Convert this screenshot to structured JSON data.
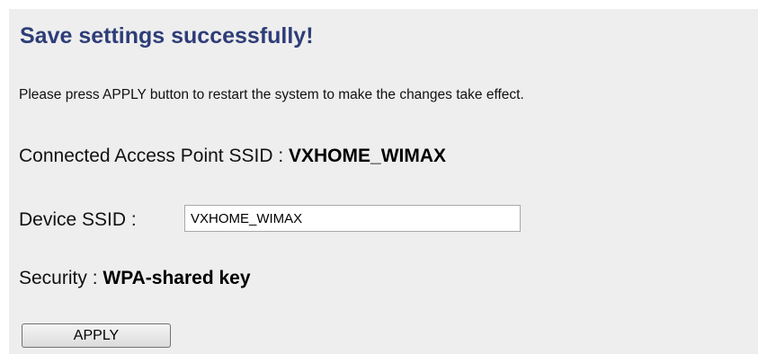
{
  "header": {
    "title": "Save settings successfully!"
  },
  "message": "Please press APPLY button to restart the system to make the changes take effect.",
  "connected_ap": {
    "label": "Connected Access Point SSID : ",
    "value": "VXHOME_WIMAX"
  },
  "device_ssid": {
    "label": "Device SSID : ",
    "value": "VXHOME_WIMAX"
  },
  "security": {
    "label": "Security : ",
    "value": "WPA-shared key"
  },
  "apply_button": {
    "label": "APPLY"
  },
  "colors": {
    "title": "#2e3d78",
    "background": "#eeeeee"
  }
}
